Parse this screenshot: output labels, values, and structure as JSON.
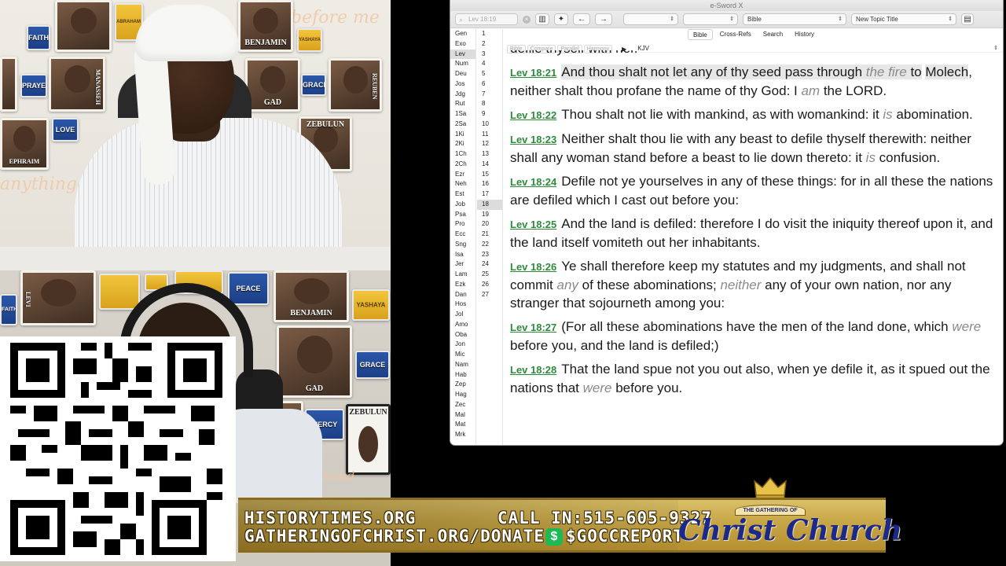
{
  "app": {
    "window_title": "e-Sword X",
    "toolbar": {
      "search_placeholder": "Lev 18:19",
      "bible_select": "Bible",
      "topic_select": "New Topic Title",
      "back_icon": "←",
      "forward_icon": "→"
    },
    "books": [
      "Gen",
      "Exo",
      "Lev",
      "Num",
      "Deu",
      "Jos",
      "Jdg",
      "Rut",
      "1Sa",
      "2Sa",
      "1Ki",
      "2Ki",
      "1Ch",
      "2Ch",
      "Ezr",
      "Neh",
      "Est",
      "Job",
      "Psa",
      "Pro",
      "Ecc",
      "Sng",
      "Isa",
      "Jer",
      "Lam",
      "Ezk",
      "Dan",
      "Hos",
      "Jol",
      "Amo",
      "Oba",
      "Jon",
      "Mic",
      "Nam",
      "Hab",
      "Zep",
      "Hag",
      "Zec",
      "Mal",
      "Mat",
      "Mrk"
    ],
    "selected_book": "Lev",
    "chapters": [
      "1",
      "2",
      "3",
      "4",
      "5",
      "6",
      "7",
      "8",
      "9",
      "10",
      "11",
      "12",
      "13",
      "14",
      "15",
      "16",
      "17",
      "18",
      "19",
      "20",
      "21",
      "22",
      "23",
      "24",
      "25",
      "26",
      "27"
    ],
    "selected_chapter": "18",
    "tabs": [
      "Bible",
      "Cross-Refs",
      "Search",
      "History"
    ],
    "active_tab": "Bible",
    "subtabs": [
      "Bible",
      "Compare",
      "Parallel",
      "Harmony"
    ],
    "play_icon": "▶",
    "version": "KJV",
    "partial_line": "defile thyself with her.",
    "verses": [
      {
        "ref": "Lev 18:21",
        "parts": [
          [
            "And thou shalt not let any of thy seed pass through ",
            "hl"
          ],
          [
            "the fire",
            "hl-it"
          ],
          [
            " to",
            "hl"
          ],
          [
            " ",
            ""
          ],
          [
            "Molech",
            "hl"
          ],
          [
            ", neither shalt thou profane the name of thy God: I ",
            ""
          ],
          [
            "am",
            "it"
          ],
          [
            " the LORD.",
            ""
          ]
        ]
      },
      {
        "ref": "Lev 18:22",
        "parts": [
          [
            "Thou shalt not lie with mankind, as with womankind: it ",
            ""
          ],
          [
            "is",
            "it"
          ],
          [
            " abomination.",
            ""
          ]
        ]
      },
      {
        "ref": "Lev 18:23",
        "parts": [
          [
            "Neither shalt thou lie with any beast to defile thyself therewith: neither shall any woman stand before a beast to lie down thereto: it ",
            ""
          ],
          [
            "is",
            "it"
          ],
          [
            " confusion.",
            ""
          ]
        ]
      },
      {
        "ref": "Lev 18:24",
        "parts": [
          [
            "Defile not ye yourselves in any of these things: for in all these the nations are defiled which I cast out before you:",
            ""
          ]
        ]
      },
      {
        "ref": "Lev 18:25",
        "parts": [
          [
            "And the land is defiled: therefore I do visit the iniquity thereof upon it, and the land itself vomiteth out her inhabitants.",
            ""
          ]
        ]
      },
      {
        "ref": "Lev 18:26",
        "parts": [
          [
            "Ye shall therefore keep my statutes and my judgments, and shall not commit ",
            ""
          ],
          [
            "any",
            "it"
          ],
          [
            " of these abominations; ",
            ""
          ],
          [
            "neither",
            "it"
          ],
          [
            " any of your own nation, nor any stranger that sojourneth among you:",
            ""
          ]
        ]
      },
      {
        "ref": "Lev 18:27",
        "parts": [
          [
            "(For all these abominations have the men of the land done, which ",
            ""
          ],
          [
            "were",
            "it"
          ],
          [
            " before you, and the land is defiled;)",
            ""
          ]
        ]
      },
      {
        "ref": "Lev 18:28",
        "parts": [
          [
            "That the land spue not you out also, when ye defile it, as it spued out the nations that ",
            ""
          ],
          [
            "were",
            "it"
          ],
          [
            " before you.",
            ""
          ]
        ]
      }
    ]
  },
  "backdrop": {
    "tiles_top": [
      "FAITH",
      "PRAYER",
      "LOVE",
      "EPHRAIM",
      "BENJAMIN",
      "YASHAYA",
      "GAD",
      "GRACE",
      "ZEBULUN",
      "REUBEN",
      "MANASSEH",
      "LEVI",
      "ABRAHAM ISAAC JACOB"
    ],
    "tiles_bottom": [
      "LEVI",
      "BENJAMIN",
      "PEACE",
      "YASHAYA",
      "GAD",
      "GRACE",
      "MERCY",
      "ZEBULUN",
      "FAITH"
    ],
    "cursive_top": [
      "before me",
      "anything"
    ],
    "cursive_bottom": [
      "thhood"
    ]
  },
  "banner": {
    "website": "HISTORYTIMES.ORG",
    "donate": "GATHERINGOFCHRIST.ORG/DONATE",
    "call_in": "CALL IN:515-605-9327",
    "cashapp": "$GOCCREPORT",
    "cashapp_symbol": "$",
    "logo_top": "THE GATHERING OF",
    "logo": "Christ Church"
  },
  "colors": {
    "verse_ref": "#2e8b3c",
    "italic_word": "#8a8a8a",
    "banner_gold": "#c9a84a",
    "logo_blue": "#1b2a8a",
    "cashapp_green": "#1db954"
  }
}
